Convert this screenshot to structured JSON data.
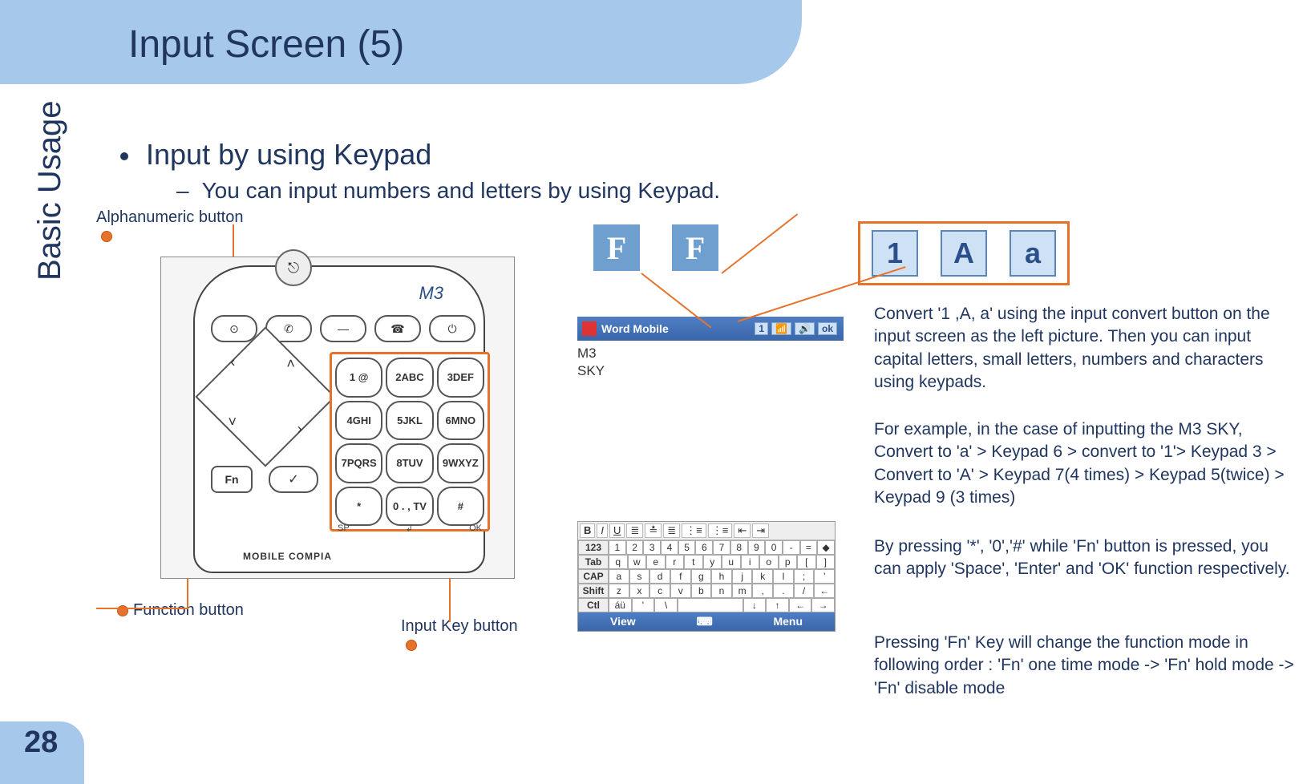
{
  "page_number": "28",
  "side_label": "Basic Usage",
  "title": "Input Screen (5)",
  "bullet_main": "Input by using Keypad",
  "bullet_sub": "You can input numbers and letters by using Keypad.",
  "annotations": {
    "alphanumeric": "Alphanumeric button",
    "function": "Function button",
    "inputkey": "Input Key button"
  },
  "device": {
    "logo": "M3",
    "brand": "MOBILE COMPIA",
    "fn_label": "Fn",
    "keys": [
      "1 @",
      "2ABC",
      "3DEF",
      "4GHI",
      "5JKL",
      "6MNO",
      "7PQRS",
      "8TUV",
      "9WXYZ",
      "*",
      "0 . , TV",
      "#"
    ],
    "sublabels": {
      "sp": "SP",
      "enter": "↲",
      "ok": "OK"
    }
  },
  "f_icons": [
    "F",
    "F"
  ],
  "mode_icons": [
    "1",
    "A",
    "a"
  ],
  "word_mobile": {
    "app": "Word Mobile",
    "status_icons": [
      "1",
      "📶",
      "🔊",
      "ok"
    ],
    "body": "M3\nSKY",
    "toolbar": [
      "B",
      "I",
      "U",
      "≣",
      "≛",
      "≣",
      "⋮≡",
      "⋮≡",
      "⇤",
      "⇥"
    ],
    "rows": {
      "123": [
        "1",
        "2",
        "3",
        "4",
        "5",
        "6",
        "7",
        "8",
        "9",
        "0",
        "-",
        "=",
        "◆"
      ],
      "Tab": [
        "q",
        "w",
        "e",
        "r",
        "t",
        "y",
        "u",
        "i",
        "o",
        "p",
        "[",
        "]"
      ],
      "CAP": [
        "a",
        "s",
        "d",
        "f",
        "g",
        "h",
        "j",
        "k",
        "l",
        ";",
        "'"
      ],
      "Shift": [
        "z",
        "x",
        "c",
        "v",
        "b",
        "n",
        "m",
        ",",
        ".",
        "/",
        "←"
      ],
      "Ctl": [
        "áü",
        "'",
        "\\",
        " ",
        "↓",
        "↑",
        "←",
        "→"
      ]
    },
    "bottom": {
      "left": "View",
      "right": "Menu"
    }
  },
  "paragraphs": {
    "p1": "Convert '1 ,A, a' using the input convert button on the input screen as the left picture. Then you can input capital letters, small letters, numbers and characters using keypads.",
    "p2": "For example, in the case of inputting the M3 SKY, Convert to 'a' > Keypad 6 > convert to '1'> Keypad 3 > Convert to 'A' > Keypad 7(4 times) > Keypad 5(twice) > Keypad 9 (3 times)",
    "p3": "By pressing '*', '0','#' while 'Fn' button is pressed, you can apply 'Space', 'Enter' and 'OK' function respectively.",
    "p4": "Pressing 'Fn' Key will change the function mode in following order : 'Fn' one time mode -> 'Fn' hold mode -> 'Fn' disable mode"
  }
}
